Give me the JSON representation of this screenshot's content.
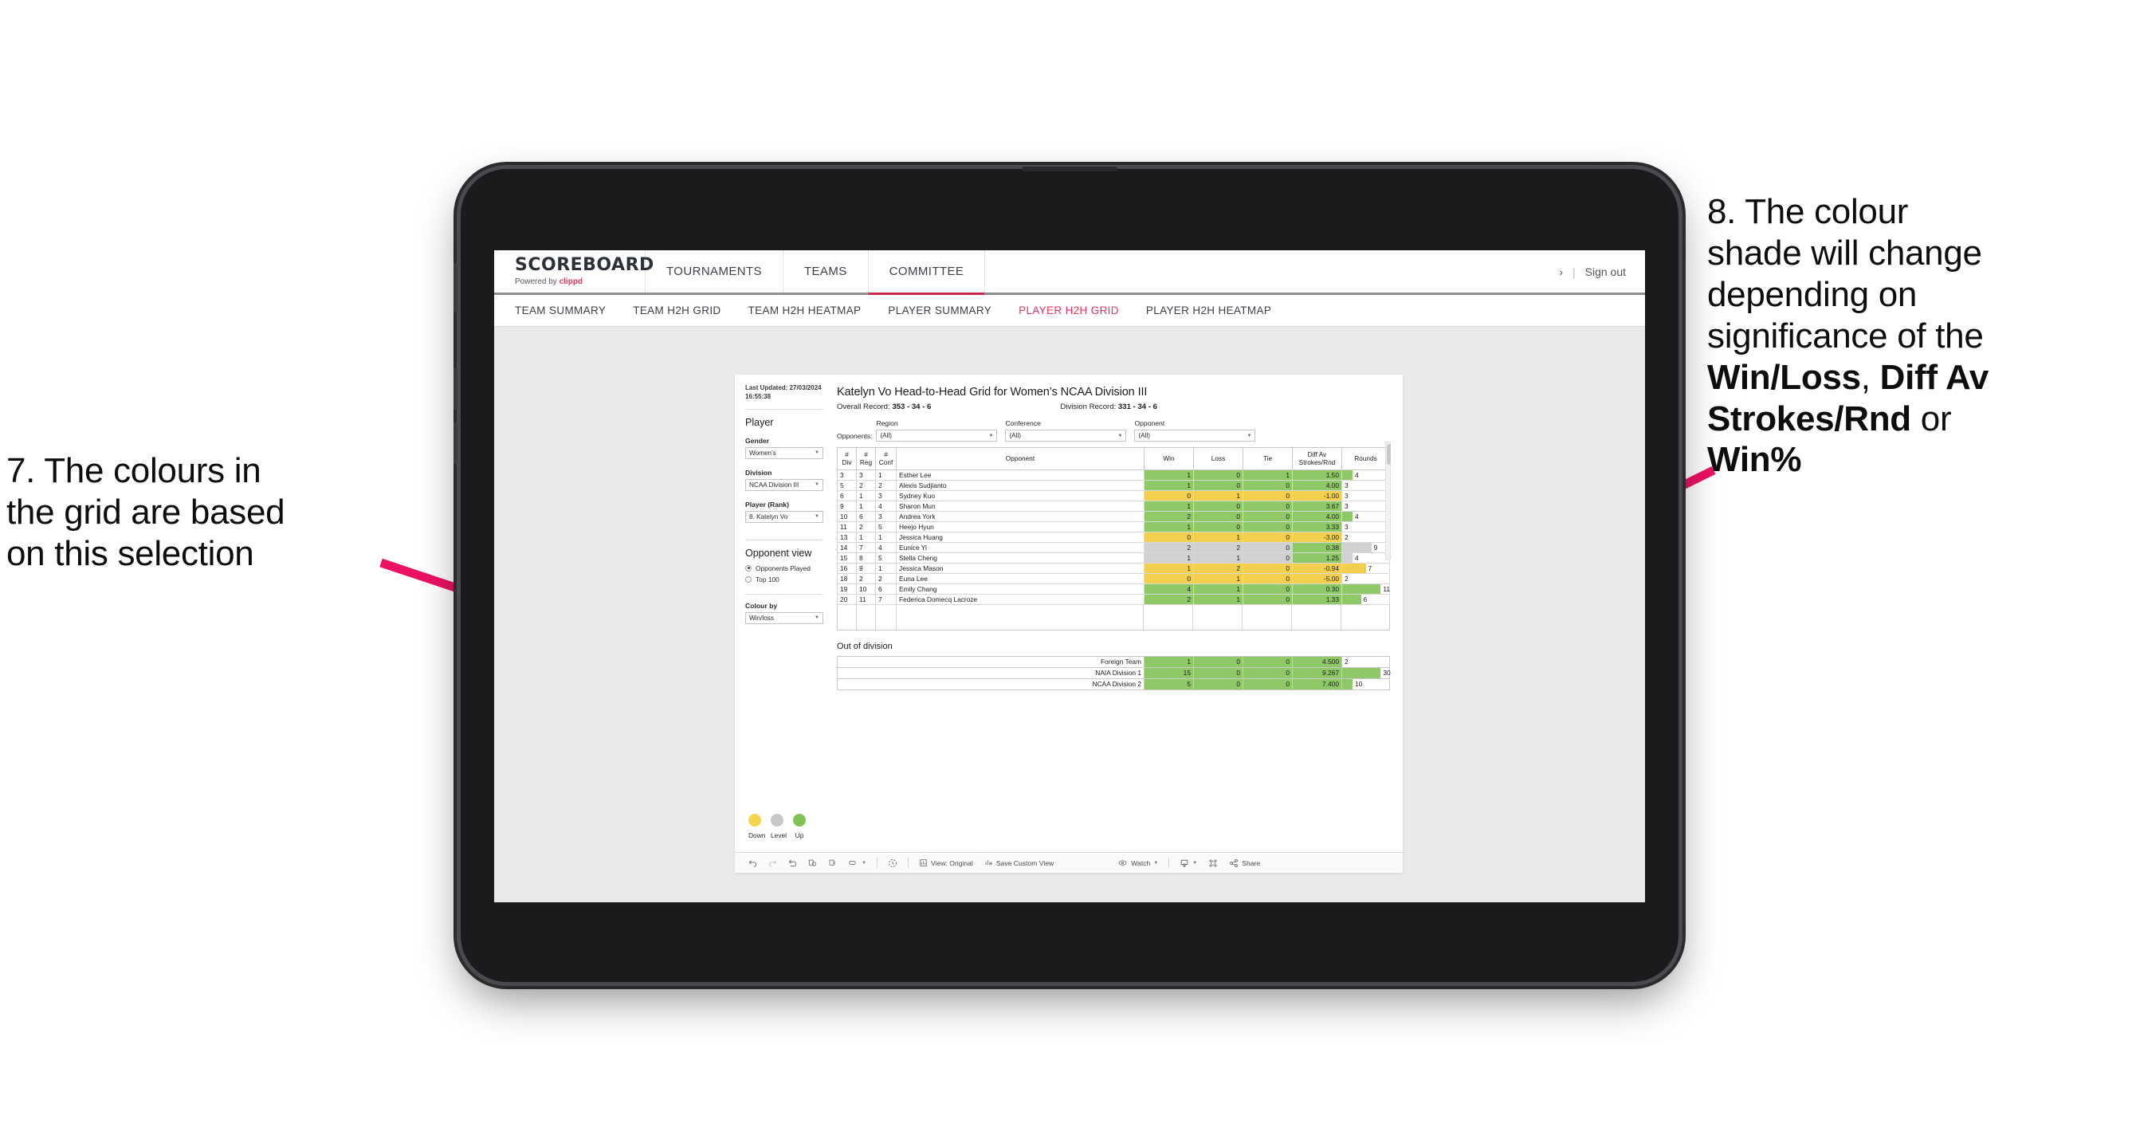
{
  "annotations": {
    "left": {
      "lines": [
        "7. The colours in",
        "the grid are based",
        "on this selection"
      ]
    },
    "right": {
      "line1": "8. The colour",
      "line2": "shade will change",
      "line3": "depending on",
      "line4": "significance of the",
      "bold1": "Win/Loss",
      "mid1": ", ",
      "bold2": "Diff Av",
      "bold3": "Strokes/Rnd",
      "mid2": " or",
      "bold4": "Win%"
    },
    "arrow_color": "#ED1164"
  },
  "app": {
    "brand": {
      "title": "SCOREBOARD",
      "powered_by": "Powered by ",
      "vendor": "clippd"
    },
    "topnav": [
      {
        "label": "TOURNAMENTS",
        "active": false
      },
      {
        "label": "TEAMS",
        "active": false
      },
      {
        "label": "COMMITTEE",
        "active": true
      }
    ],
    "header_right": {
      "chevron": "›",
      "divider": "|",
      "sign_out": "Sign out"
    },
    "subnav": [
      {
        "label": "TEAM SUMMARY",
        "active": false
      },
      {
        "label": "TEAM H2H GRID",
        "active": false
      },
      {
        "label": "TEAM H2H HEATMAP",
        "active": false
      },
      {
        "label": "PLAYER SUMMARY",
        "active": false
      },
      {
        "label": "PLAYER H2H GRID",
        "active": true
      },
      {
        "label": "PLAYER H2H HEATMAP",
        "active": false
      }
    ],
    "accent": "#e8335c"
  },
  "sidebar": {
    "last_updated_label": "Last Updated: 27/03/2024",
    "last_updated_time": "16:55:38",
    "player_heading": "Player",
    "gender": {
      "label": "Gender",
      "value": "Women’s"
    },
    "division": {
      "label": "Division",
      "value": "NCAA Division III"
    },
    "player_rank": {
      "label": "Player (Rank)",
      "value": "8. Katelyn Vo"
    },
    "opponent_view": {
      "heading": "Opponent view",
      "options": [
        {
          "label": "Opponents Played",
          "selected": true
        },
        {
          "label": "Top 100",
          "selected": false
        }
      ]
    },
    "colour_by": {
      "label": "Colour by",
      "value": "Win/loss"
    },
    "legend": [
      {
        "label": "Down",
        "color": "#f5d44c"
      },
      {
        "label": "Level",
        "color": "#c6c8ca"
      },
      {
        "label": "Up",
        "color": "#81c254"
      }
    ]
  },
  "viz": {
    "title": "Katelyn Vo Head-to-Head Grid for Women’s NCAA Division III",
    "overall_record_label": "Overall Record: ",
    "overall_record_value": "353 -  34 - 6",
    "division_record_label": "Division Record: ",
    "division_record_value": "331 -  34 - 6",
    "opponents_label": "Opponents:",
    "filters": [
      {
        "label": "Region",
        "value": "(All)"
      },
      {
        "label": "Conference",
        "value": "(All)"
      },
      {
        "label": "Opponent",
        "value": "(All)"
      }
    ]
  },
  "chart_data": {
    "type": "table",
    "title": "Katelyn Vo Head-to-Head Grid for Women’s NCAA Division III",
    "columns": [
      "# Div",
      "# Reg",
      "# Conf",
      "Opponent",
      "Win",
      "Loss",
      "Tie",
      "Diff Av Strokes/Rnd",
      "Rounds"
    ],
    "column_head_lines": [
      [
        "#",
        "Div"
      ],
      [
        "#",
        "Reg"
      ],
      [
        "#",
        "Conf"
      ],
      [
        "Opponent"
      ],
      [
        "Win"
      ],
      [
        "Loss"
      ],
      [
        "Tie"
      ],
      [
        "Diff Av",
        "Strokes/Rnd"
      ],
      [
        "Rounds"
      ]
    ],
    "colour_scale": {
      "up": "#8fc866",
      "level": "#cfd1d3",
      "down": "#f2d04e"
    },
    "rows": [
      {
        "div": "3",
        "reg": "3",
        "conf": "1",
        "opponent": "Esther Lee",
        "win": "1",
        "loss": "0",
        "tie": "1",
        "diff": "1.50",
        "rounds": "4",
        "shade": "up",
        "bar_pct": 22
      },
      {
        "div": "5",
        "reg": "2",
        "conf": "2",
        "opponent": "Alexis Sudjianto",
        "win": "1",
        "loss": "0",
        "tie": "0",
        "diff": "4.00",
        "rounds": "3",
        "shade": "up",
        "bar_pct": 0
      },
      {
        "div": "6",
        "reg": "1",
        "conf": "3",
        "opponent": "Sydney Kuo",
        "win": "0",
        "loss": "1",
        "tie": "0",
        "diff": "-1.00",
        "rounds": "3",
        "shade": "down",
        "bar_pct": 0
      },
      {
        "div": "9",
        "reg": "1",
        "conf": "4",
        "opponent": "Sharon Mun",
        "win": "1",
        "loss": "0",
        "tie": "0",
        "diff": "3.67",
        "rounds": "3",
        "shade": "up",
        "bar_pct": 0
      },
      {
        "div": "10",
        "reg": "6",
        "conf": "3",
        "opponent": "Andrea York",
        "win": "2",
        "loss": "0",
        "tie": "0",
        "diff": "4.00",
        "rounds": "4",
        "shade": "up",
        "bar_pct": 22
      },
      {
        "div": "11",
        "reg": "2",
        "conf": "5",
        "opponent": "Heejo Hyun",
        "win": "1",
        "loss": "0",
        "tie": "0",
        "diff": "3.33",
        "rounds": "3",
        "shade": "up",
        "bar_pct": 0
      },
      {
        "div": "13",
        "reg": "1",
        "conf": "1",
        "opponent": "Jessica Huang",
        "win": "0",
        "loss": "1",
        "tie": "0",
        "diff": "-3.00",
        "rounds": "2",
        "shade": "down",
        "bar_pct": 0
      },
      {
        "div": "14",
        "reg": "7",
        "conf": "4",
        "opponent": "Eunice Yi",
        "win": "2",
        "loss": "2",
        "tie": "0",
        "diff": "0.38",
        "rounds": "9",
        "shade": "level",
        "bar_pct": 62,
        "diff_shade": "up"
      },
      {
        "div": "15",
        "reg": "8",
        "conf": "5",
        "opponent": "Stella Cheng",
        "win": "1",
        "loss": "1",
        "tie": "0",
        "diff": "1.25",
        "rounds": "4",
        "shade": "level",
        "bar_pct": 22,
        "diff_shade": "up"
      },
      {
        "div": "16",
        "reg": "9",
        "conf": "1",
        "opponent": "Jessica Mason",
        "win": "1",
        "loss": "2",
        "tie": "0",
        "diff": "-0.94",
        "rounds": "7",
        "shade": "down",
        "bar_pct": 50
      },
      {
        "div": "18",
        "reg": "2",
        "conf": "2",
        "opponent": "Euna Lee",
        "win": "0",
        "loss": "1",
        "tie": "0",
        "diff": "-5.00",
        "rounds": "2",
        "shade": "down",
        "bar_pct": 0
      },
      {
        "div": "19",
        "reg": "10",
        "conf": "6",
        "opponent": "Emily Chang",
        "win": "4",
        "loss": "1",
        "tie": "0",
        "diff": "0.30",
        "rounds": "11",
        "shade": "up",
        "bar_pct": 82
      },
      {
        "div": "20",
        "reg": "11",
        "conf": "7",
        "opponent": "Federica Domecq Lacroze",
        "win": "2",
        "loss": "1",
        "tie": "0",
        "diff": "1.33",
        "rounds": "6",
        "shade": "up",
        "bar_pct": 40
      }
    ],
    "out_of_division": {
      "title": "Out of division",
      "rows": [
        {
          "name": "Foreign Team",
          "win": "1",
          "loss": "0",
          "tie": "0",
          "diff": "4.500",
          "rounds": "2",
          "shade": "up",
          "bar_pct": 0
        },
        {
          "name": "NAIA Division 1",
          "win": "15",
          "loss": "0",
          "tie": "0",
          "diff": "9.267",
          "rounds": "30",
          "shade": "up",
          "bar_pct": 82
        },
        {
          "name": "NCAA Division 2",
          "win": "5",
          "loss": "0",
          "tie": "0",
          "diff": "7.400",
          "rounds": "10",
          "shade": "up",
          "bar_pct": 22
        }
      ]
    }
  },
  "toolbar": {
    "undo": "undo-icon",
    "redo": "redo-icon",
    "revert": "revert-icon",
    "refresh": "refresh-icon",
    "pause": "pause-icon",
    "view_original": "View: Original",
    "save_custom_view": "Save Custom View",
    "watch": "Watch",
    "share": "Share"
  }
}
